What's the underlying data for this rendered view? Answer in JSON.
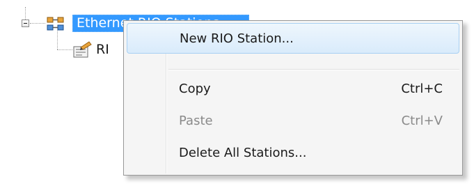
{
  "tree": {
    "root": {
      "label": "Ethernet RIO Stations",
      "icon": "network-icon",
      "expanded": true,
      "selected": true
    },
    "child": {
      "label": "RI",
      "icon": "rio-station-icon"
    },
    "expander_icon": "collapse-minus-icon"
  },
  "context_menu": {
    "items": [
      {
        "label": "New RIO Station...",
        "shortcut": "",
        "enabled": true,
        "highlighted": true
      },
      {
        "label": "Copy",
        "shortcut": "Ctrl+C",
        "enabled": true,
        "highlighted": false
      },
      {
        "label": "Paste",
        "shortcut": "Ctrl+V",
        "enabled": false,
        "highlighted": false
      },
      {
        "label": "Delete All Stations...",
        "shortcut": "",
        "enabled": true,
        "highlighted": false
      }
    ]
  },
  "colors": {
    "selection": "#3399ff",
    "menu_background": "#f5f5f5",
    "highlight_border": "#a8d0f3",
    "disabled_text": "#8a8a8a"
  }
}
